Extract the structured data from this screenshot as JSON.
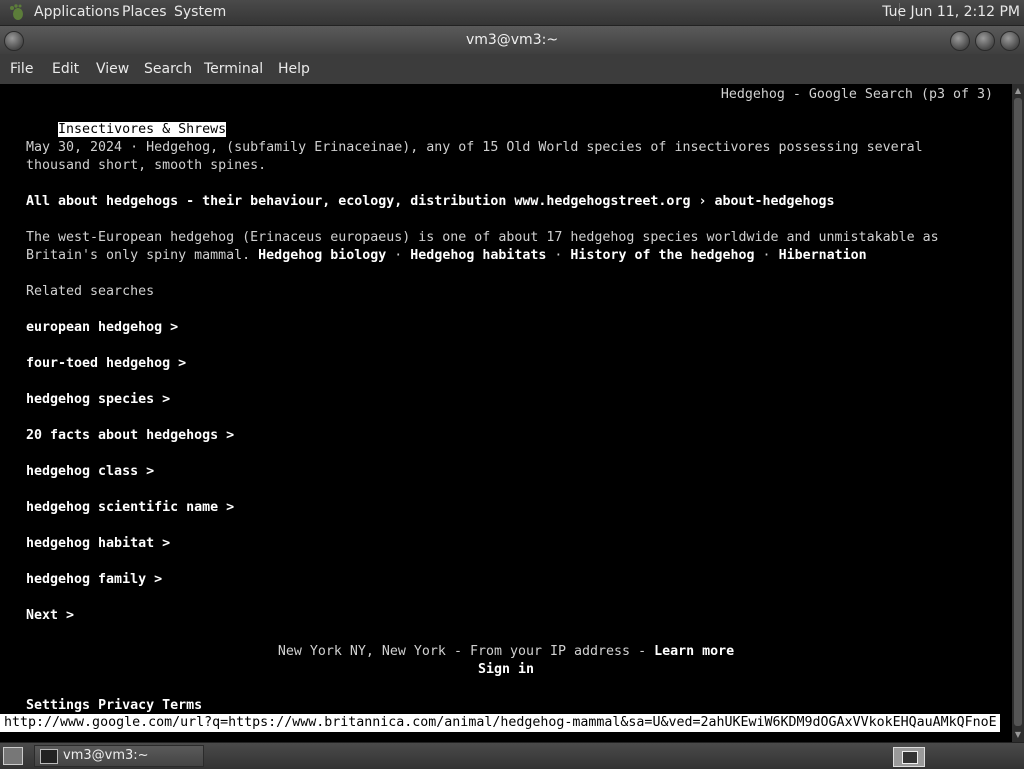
{
  "top_panel": {
    "menus": [
      "Applications",
      "Places",
      "System"
    ],
    "clock": "Tue Jun 11,  2:12 PM"
  },
  "window": {
    "title": "vm3@vm3:~"
  },
  "menubar": {
    "items": [
      "File",
      "Edit",
      "View",
      "Search",
      "Terminal",
      "Help"
    ]
  },
  "terminal": {
    "page_indicator": "Hedgehog - Google Search (p3 of 3)",
    "heading_cursor_char": "I",
    "heading_rest": "nsectivores & Shrews",
    "snippet1_line1": "May 30, 2024 · Hedgehog, (subfamily Erinaceinae), any of 15 Old World species of insectivores possessing several",
    "snippet1_line2": "thousand short, smooth spines.",
    "result2_link": "All about hedgehogs - their behaviour, ecology, distribution www.hedgehogstreet.org › about-hedgehogs",
    "snippet2_line1": "The west-European hedgehog (Erinaceus europaeus) is one of about 17 hedgehog species worldwide and unmistakable as",
    "snippet2_line2_plain": "Britain's only spiny mammal. ",
    "snippet2_links": [
      "Hedgehog biology",
      "Hedgehog habitats",
      "History of the hedgehog",
      "Hibernation"
    ],
    "link_separator": " · ",
    "related_heading": "Related searches",
    "related": [
      "european hedgehog >",
      "four-toed hedgehog >",
      "hedgehog species >",
      "20 facts about hedgehogs >",
      "hedgehog class >",
      "hedgehog scientific name >",
      "hedgehog habitat >",
      "hedgehog family >"
    ],
    "next": "Next >",
    "location_text": "New York NY, New York - From your IP address - ",
    "learn_more": "Learn more",
    "sign_in": "Sign in",
    "footer_links": [
      "Settings",
      "Privacy",
      "Terms"
    ],
    "status_url": "http://www.google.com/url?q=https://www.britannica.com/animal/hedgehog-mammal&sa=U&ved=2ahUKEwiW6KDM9dOGAxVVkokEHQauAMkQFnoE"
  },
  "taskbar": {
    "task_label": "vm3@vm3:~"
  }
}
